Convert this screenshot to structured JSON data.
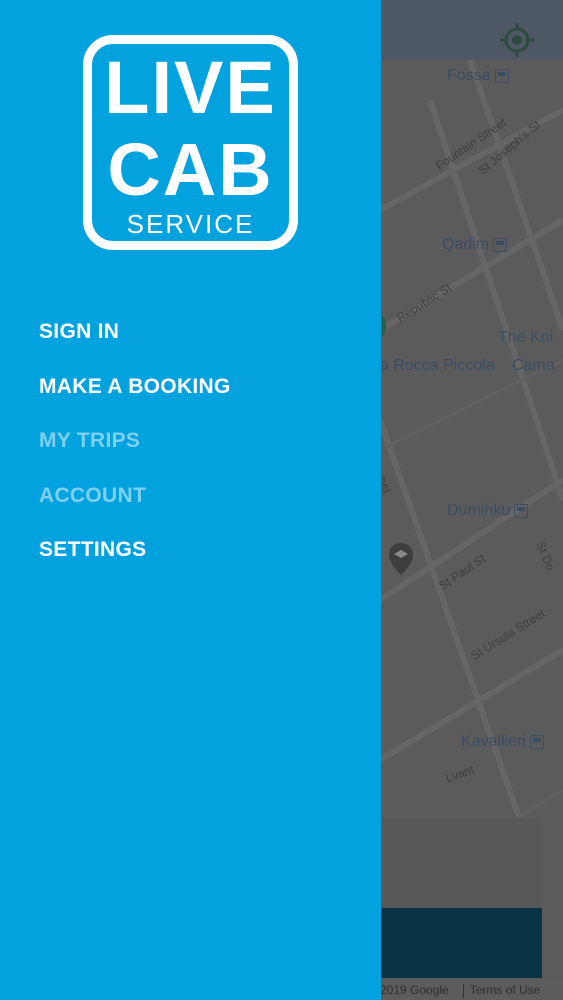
{
  "logo": {
    "line1": "LIVE",
    "line2": "CAB",
    "line3": "SERVICE"
  },
  "menu": {
    "items": [
      {
        "label": "SIGN IN",
        "enabled": true
      },
      {
        "label": "MAKE A BOOKING",
        "enabled": true
      },
      {
        "label": "MY TRIPS",
        "enabled": false
      },
      {
        "label": "ACCOUNT",
        "enabled": false
      },
      {
        "label": "SETTINGS",
        "enabled": true
      }
    ]
  },
  "map": {
    "places": {
      "fossa": "Fossa",
      "qadim": "Qadim",
      "knights": "The Kni",
      "rocca": "a Rocca Piccola",
      "cama": "Cama",
      "duminku": "Duminku",
      "kavallieri": "Kavallieri"
    },
    "streets": {
      "fountain": "Fountain Street",
      "stjoseph": "St Joseph's St",
      "republic": "Republic St",
      "stpaul": "St Paul St",
      "stursula": "St Ursula Street",
      "stdo": "St Do",
      "lvant": "Lvant",
      "eet": "eet"
    },
    "attribution": {
      "copyright": "2019 Google",
      "terms": "Terms of Use"
    }
  },
  "colors": {
    "drawer": "#02a2de",
    "active_item": "#ffffff",
    "disabled_item": "#7fd0ef"
  }
}
